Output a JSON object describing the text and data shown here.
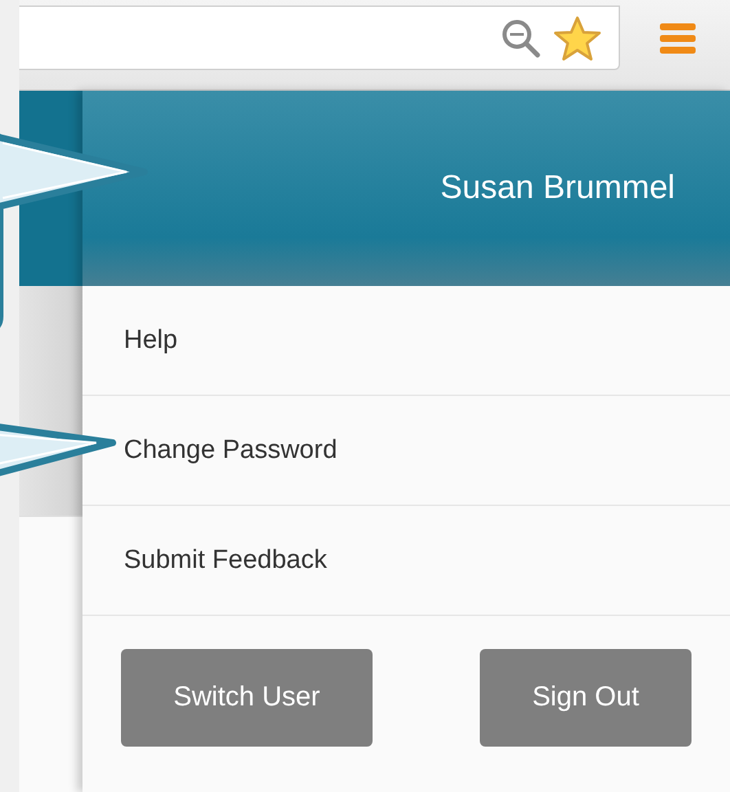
{
  "header": {
    "user_name": "Susan Brummel"
  },
  "menu_items": [
    {
      "label": "Help"
    },
    {
      "label": "Change Password"
    },
    {
      "label": "Submit Feedback"
    }
  ],
  "buttons": [
    {
      "label": "Switch User"
    },
    {
      "label": "Sign Out"
    }
  ]
}
